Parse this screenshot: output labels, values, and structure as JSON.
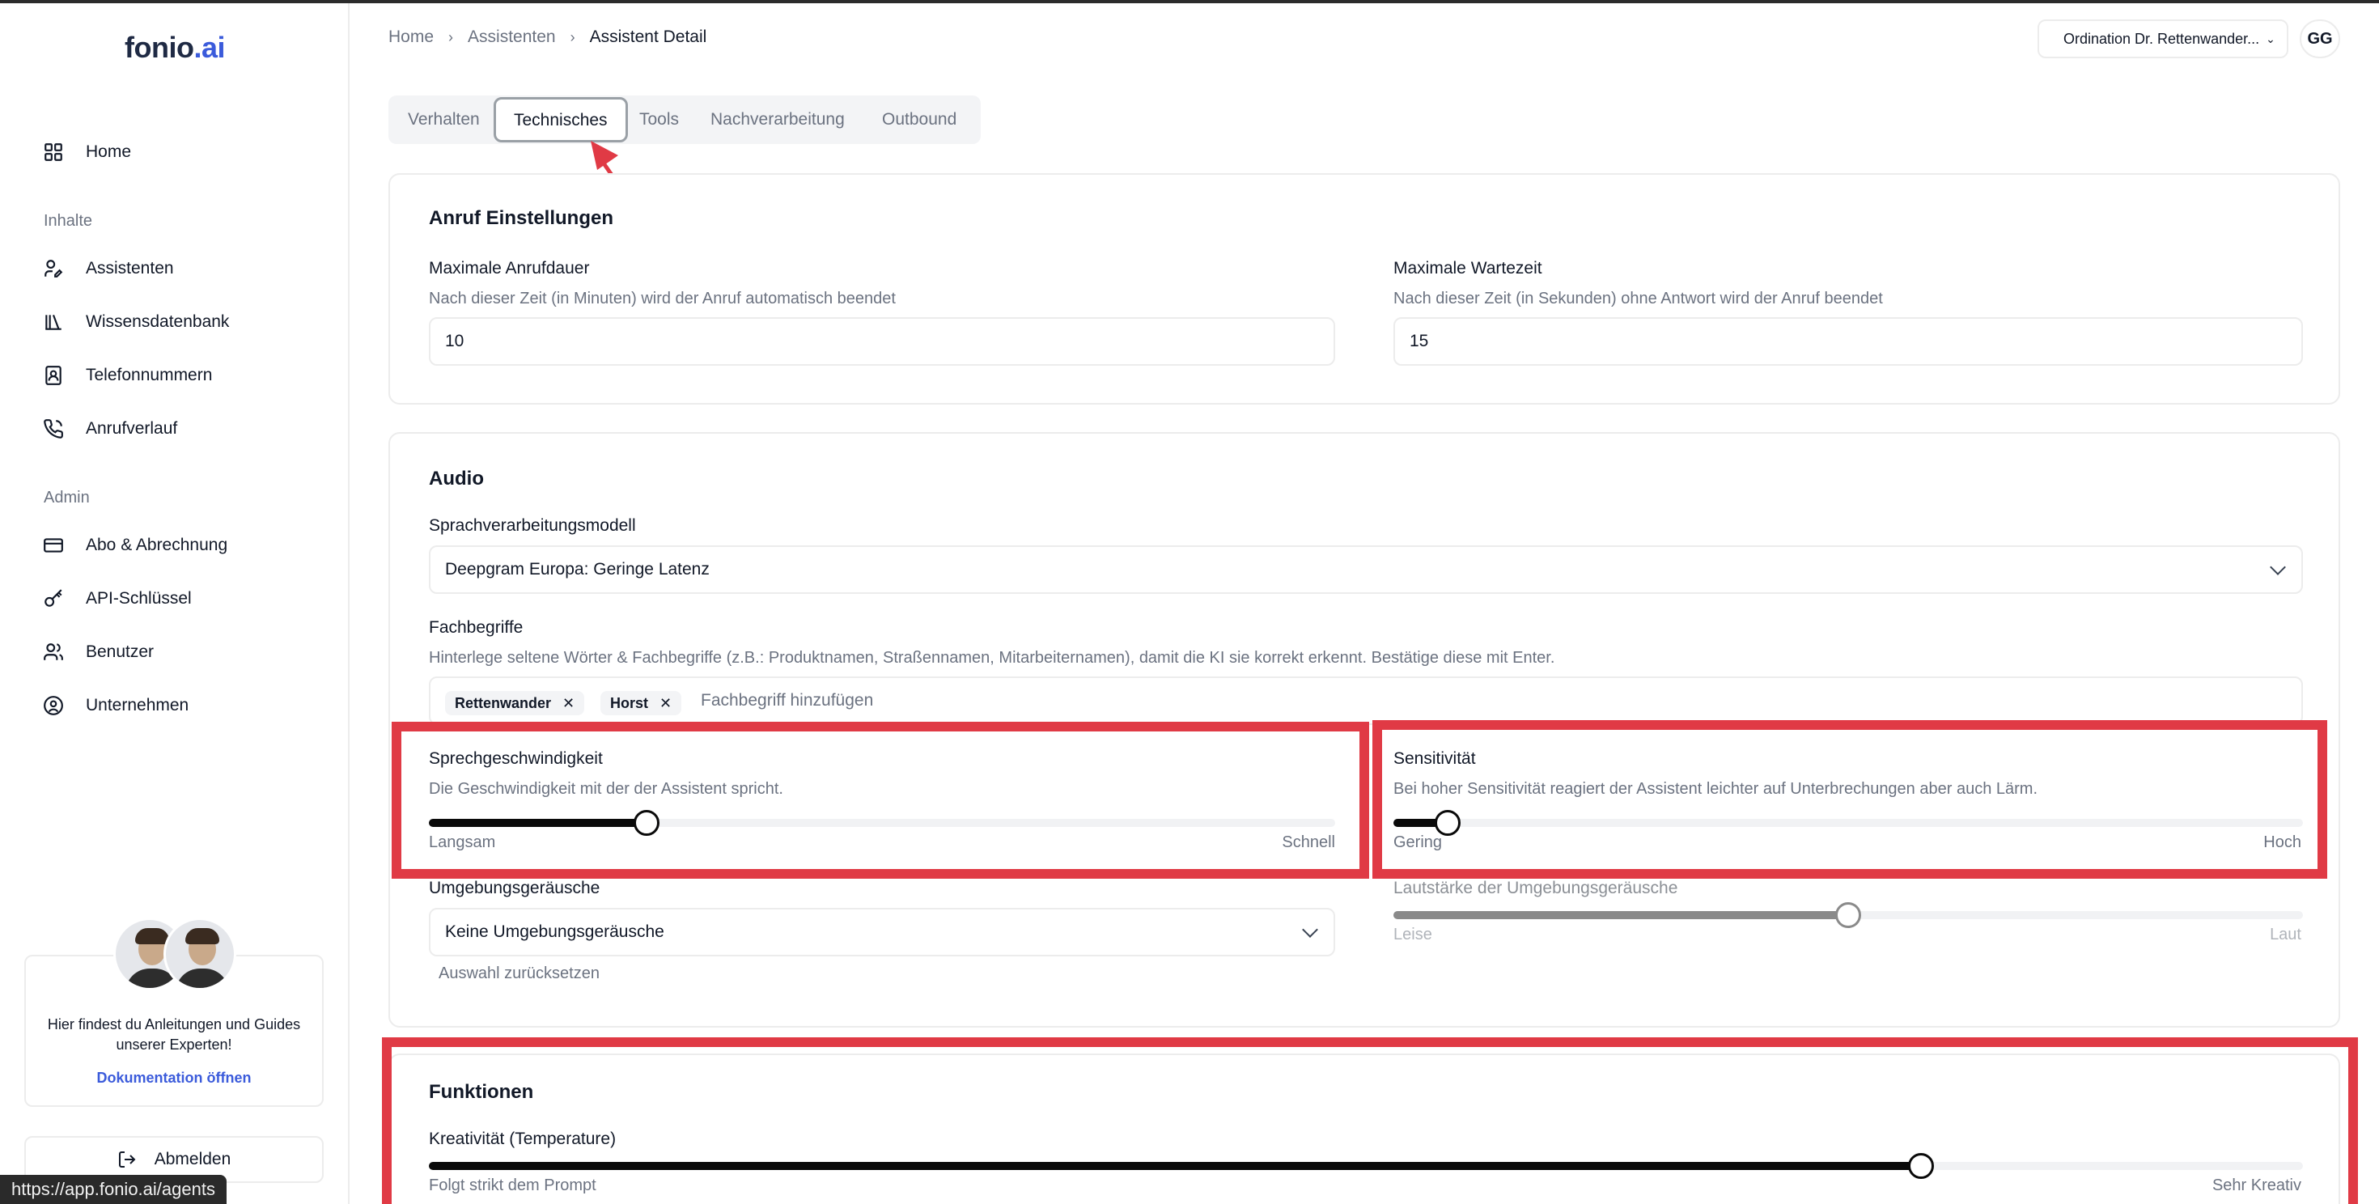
{
  "sidebar": {
    "logo_main": "fonio",
    "logo_ai": ".ai",
    "items": [
      {
        "label": "Home"
      },
      {
        "label": "Assistenten"
      },
      {
        "label": "Wissensdatenbank"
      },
      {
        "label": "Telefonnummern"
      },
      {
        "label": "Anrufverlauf"
      },
      {
        "label": "Abo & Abrechnung"
      },
      {
        "label": "API-Schlüssel"
      },
      {
        "label": "Benutzer"
      },
      {
        "label": "Unternehmen"
      }
    ],
    "section_content": "Inhalte",
    "section_admin": "Admin",
    "doc_text": "Hier findest du Anleitungen und Guides unserer Experten!",
    "doc_link": "Dokumentation öffnen",
    "logout": "Abmelden"
  },
  "status_url": "https://app.fonio.ai/agents",
  "header": {
    "breadcrumb": [
      "Home",
      "Assistenten",
      "Assistent Detail"
    ],
    "org": "Ordination Dr. Rettenwander...",
    "user_initials": "GG"
  },
  "tabs": [
    {
      "label": "Verhalten"
    },
    {
      "label": "Technisches"
    },
    {
      "label": "Tools"
    },
    {
      "label": "Nachverarbeitung"
    },
    {
      "label": "Outbound"
    }
  ],
  "call_settings": {
    "title": "Anruf Einstellungen",
    "max_duration_label": "Maximale Anrufdauer",
    "max_duration_desc": "Nach dieser Zeit (in Minuten) wird der Anruf automatisch beendet",
    "max_duration_value": "10",
    "max_wait_label": "Maximale Wartezeit",
    "max_wait_desc": "Nach dieser Zeit (in Sekunden) ohne Antwort wird der Anruf beendet",
    "max_wait_value": "15"
  },
  "audio": {
    "title": "Audio",
    "model_label": "Sprachverarbeitungsmodell",
    "model_value": "Deepgram Europa: Geringe Latenz",
    "terms_label": "Fachbegriffe",
    "terms_desc": "Hinterlege seltene Wörter & Fachbegriffe (z.B.: Produktnamen, Straßennamen, Mitarbeiternamen), damit die KI sie korrekt erkennt. Bestätige diese mit Enter.",
    "terms_tags": [
      "Rettenwander",
      "Horst"
    ],
    "terms_placeholder": "Fachbegriff hinzufügen",
    "speed_label": "Sprechgeschwindigkeit",
    "speed_desc": "Die Geschwindigkeit mit der der Assistent spricht.",
    "speed_min": "Langsam",
    "speed_max": "Schnell",
    "speed_value": 0.24,
    "sens_label": "Sensitivität",
    "sens_desc": "Bei hoher Sensitivität reagiert der Assistent leichter auf Unterbrechungen aber auch Lärm.",
    "sens_min": "Gering",
    "sens_max": "Hoch",
    "sens_value": 0.06,
    "ambient_label": "Umgebungsgeräusche",
    "ambient_value": "Keine Umgebungsgeräusche",
    "ambient_reset": "Auswahl zurücksetzen",
    "volume_label": "Lautstärke der Umgebungsgeräusche",
    "volume_min": "Leise",
    "volume_max": "Laut",
    "volume_value": 0.5
  },
  "functions": {
    "title": "Funktionen",
    "creativity_label": "Kreativität (Temperature)",
    "creativity_min": "Folgt strikt dem Prompt",
    "creativity_max": "Sehr Kreativ",
    "creativity_value": 0.796
  },
  "colors": {
    "accent": "#3b5bdb",
    "highlight": "#e03a45",
    "slider": "#0a0a0a"
  }
}
